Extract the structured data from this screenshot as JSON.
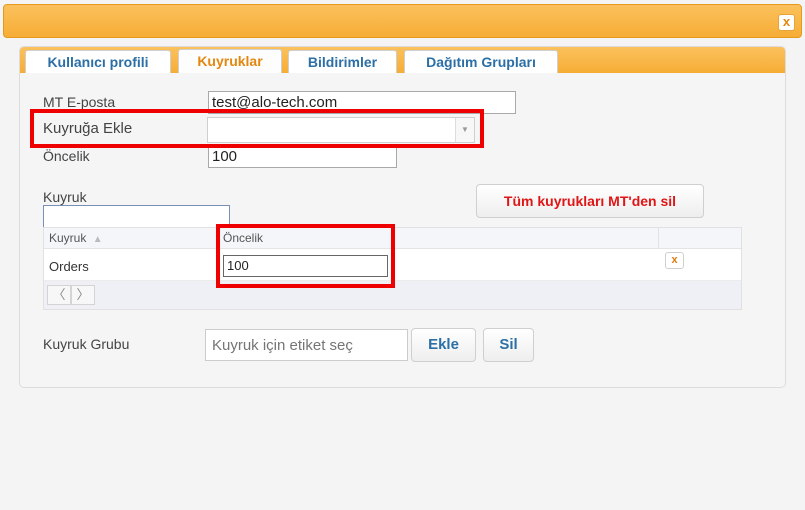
{
  "dialog": {
    "close_label": "x"
  },
  "tabs": [
    {
      "label": "Kullanıcı profili"
    },
    {
      "label": "Kuyruklar"
    },
    {
      "label": "Bildirimler"
    },
    {
      "label": "Dağıtım Grupları"
    }
  ],
  "form": {
    "email_label": "MT E-posta",
    "email_value": "test@alo-tech.com",
    "add_queue_label": "Kuyruğa Ekle",
    "add_queue_value": "",
    "priority_label": "Öncelik",
    "priority_value": "100"
  },
  "queue_filter": {
    "label": "Kuyruk",
    "value": ""
  },
  "delete_all_button": "Tüm kuyrukları MT'den sil",
  "grid": {
    "columns": [
      "Kuyruk",
      "Öncelik"
    ],
    "sort_icon": "▲",
    "rows": [
      {
        "queue": "Orders",
        "priority": "100",
        "delete_label": "x"
      }
    ],
    "pager_prev": "〈",
    "pager_next": "〉"
  },
  "queue_group": {
    "label": "Kuyruk Grubu",
    "placeholder": "Kuyruk için etiket seç",
    "add_label": "Ekle",
    "remove_label": "Sil"
  },
  "colors": {
    "accent_orange": "#f6ad35",
    "link_blue": "#2b6fa6",
    "danger_red": "#ee0000"
  }
}
